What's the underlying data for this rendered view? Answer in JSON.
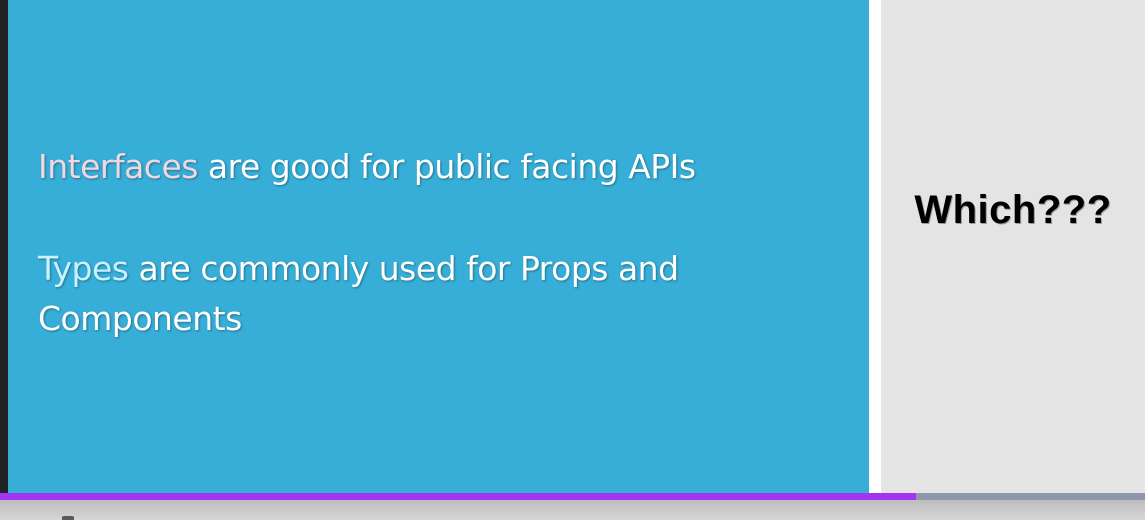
{
  "slide": {
    "main": {
      "paragraphs": [
        {
          "keyword": "Interfaces",
          "rest": " are good for public facing APIs"
        },
        {
          "keyword": "Types",
          "rest": " are commonly used for Props and Components"
        }
      ]
    },
    "side": {
      "title": "Which???"
    }
  },
  "player": {
    "progress_fraction": 0.8
  },
  "colors": {
    "slide_background": "#36aed8",
    "side_background": "#e4e4e4",
    "progress_fill": "#a135f2",
    "progress_track": "#8e97aa"
  }
}
